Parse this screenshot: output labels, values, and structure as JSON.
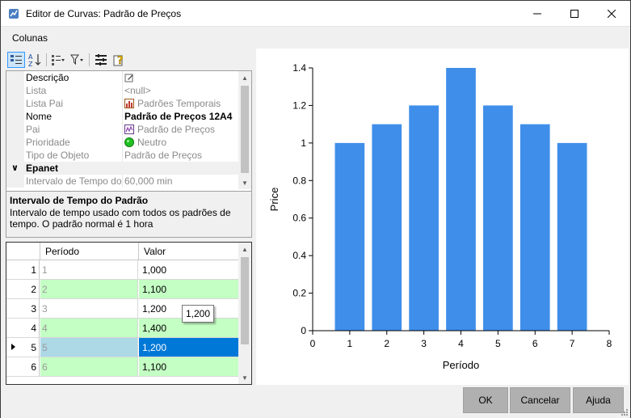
{
  "window": {
    "title": "Editor de Curvas: Padrão de Preços"
  },
  "menu": {
    "items": [
      "Colunas"
    ]
  },
  "toolbar": {
    "buttons": [
      "categorized-icon",
      "sort-alpha-icon",
      "expand-icon",
      "filter-icon",
      "properties-icon",
      "help-icon"
    ]
  },
  "properties": {
    "rows": [
      {
        "name": "Descrição",
        "value": "",
        "gray": false,
        "icon": "edit-icon"
      },
      {
        "name": "Lista",
        "value": "<null>",
        "gray": true,
        "icon": ""
      },
      {
        "name": "Lista Pai",
        "value": "Padrões Temporais",
        "gray": true,
        "icon": "chart-icon"
      },
      {
        "name": "Nome",
        "value": "Padrão de Preços 12A4",
        "gray": false,
        "bold": true,
        "icon": ""
      },
      {
        "name": "Pai",
        "value": "Padrão de Preços",
        "gray": true,
        "icon": "pattern-icon"
      },
      {
        "name": "Prioridade",
        "value": "Neutro",
        "gray": true,
        "icon": "green-dot-icon"
      },
      {
        "name": "Tipo de Objeto",
        "value": "Padrão de Preços",
        "gray": true,
        "icon": ""
      }
    ],
    "category": "Epanet",
    "category_rows": [
      {
        "name": "Intervalo de Tempo do P",
        "value": "60,000 min",
        "gray": true
      }
    ]
  },
  "description": {
    "title": "Intervalo de Tempo do Padrão",
    "text": "Intervalo de tempo usado com todos os padrões de tempo. O padrão normal é 1 hora"
  },
  "grid": {
    "columns": [
      "Período",
      "Valor"
    ],
    "rows": [
      {
        "num": "1",
        "period": "1",
        "value": "1,000",
        "highlight": false,
        "selected": false
      },
      {
        "num": "2",
        "period": "2",
        "value": "1,100",
        "highlight": true,
        "selected": false
      },
      {
        "num": "3",
        "period": "3",
        "value": "1,200",
        "highlight": false,
        "selected": false
      },
      {
        "num": "4",
        "period": "4",
        "value": "1,400",
        "highlight": true,
        "selected": false
      },
      {
        "num": "5",
        "period": "5",
        "value": "1,200",
        "highlight": false,
        "selected": true
      },
      {
        "num": "6",
        "period": "6",
        "value": "1,100",
        "highlight": true,
        "selected": false
      }
    ],
    "tooltip": "1,200"
  },
  "chart_data": {
    "type": "bar",
    "x": [
      1,
      2,
      3,
      4,
      5,
      6,
      7
    ],
    "values": [
      1.0,
      1.1,
      1.2,
      1.4,
      1.2,
      1.1,
      1.0
    ],
    "xlabel": "Período",
    "ylabel": "Price",
    "xlim": [
      0,
      8
    ],
    "ylim": [
      0,
      1.4
    ],
    "xticks": [
      "0",
      "1",
      "2",
      "3",
      "4",
      "5",
      "6",
      "7",
      "8"
    ],
    "yticks": [
      "0",
      "0.2",
      "0.4",
      "0.6",
      "0.8",
      "1",
      "1.2",
      "1.4"
    ],
    "bar_color": "#3f8eea",
    "grid": false
  },
  "buttons": {
    "ok": "OK",
    "cancel": "Cancelar",
    "help": "Ajuda"
  },
  "colors": {
    "highlight_row": "#c4ffc4",
    "selected_cell": "#0078d7",
    "selected_row": "#add8e6"
  }
}
